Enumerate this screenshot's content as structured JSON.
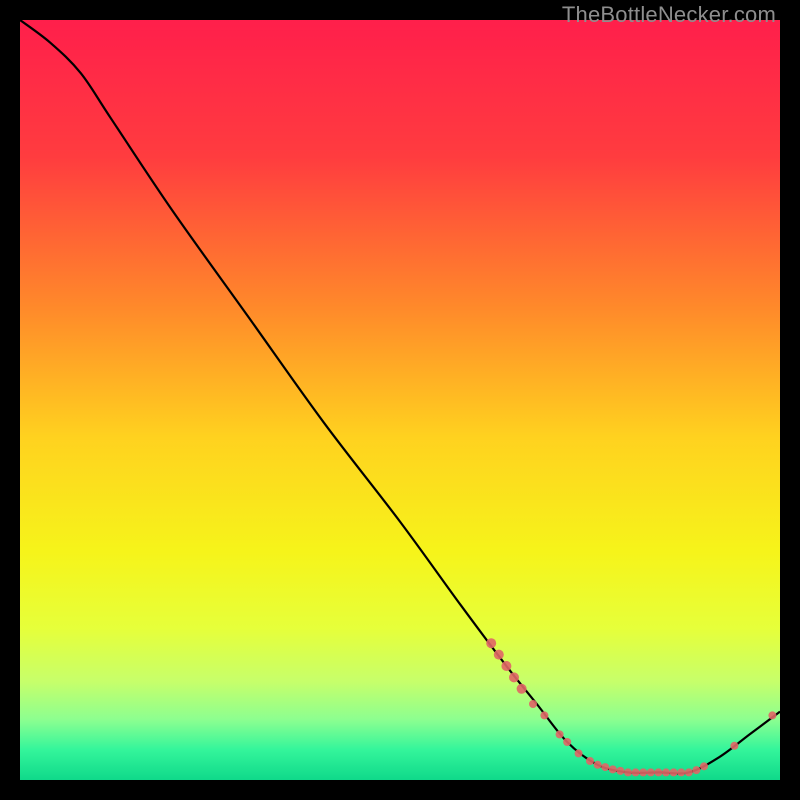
{
  "watermark": "TheBottleNecker.com",
  "chart_data": {
    "type": "line",
    "title": "",
    "xlabel": "",
    "ylabel": "",
    "xlim": [
      0,
      100
    ],
    "ylim": [
      0,
      100
    ],
    "gradient_stops": [
      {
        "offset": 0.0,
        "color": "#ff1f4b"
      },
      {
        "offset": 0.18,
        "color": "#ff3c3f"
      },
      {
        "offset": 0.38,
        "color": "#ff8a2a"
      },
      {
        "offset": 0.55,
        "color": "#ffd21f"
      },
      {
        "offset": 0.7,
        "color": "#f6f41a"
      },
      {
        "offset": 0.8,
        "color": "#e6ff3a"
      },
      {
        "offset": 0.87,
        "color": "#c7ff6a"
      },
      {
        "offset": 0.92,
        "color": "#8dff90"
      },
      {
        "offset": 0.96,
        "color": "#34f59b"
      },
      {
        "offset": 1.0,
        "color": "#0fd98a"
      }
    ],
    "curve": [
      {
        "x": 0,
        "y": 100
      },
      {
        "x": 4,
        "y": 97
      },
      {
        "x": 8,
        "y": 93
      },
      {
        "x": 12,
        "y": 87
      },
      {
        "x": 20,
        "y": 75
      },
      {
        "x": 30,
        "y": 61
      },
      {
        "x": 40,
        "y": 47
      },
      {
        "x": 50,
        "y": 34
      },
      {
        "x": 58,
        "y": 23
      },
      {
        "x": 64,
        "y": 15
      },
      {
        "x": 68,
        "y": 10
      },
      {
        "x": 72,
        "y": 5
      },
      {
        "x": 76,
        "y": 2
      },
      {
        "x": 80,
        "y": 1
      },
      {
        "x": 84,
        "y": 1
      },
      {
        "x": 88,
        "y": 1
      },
      {
        "x": 92,
        "y": 3
      },
      {
        "x": 96,
        "y": 6
      },
      {
        "x": 100,
        "y": 9
      }
    ],
    "highlight_points": [
      {
        "x": 62,
        "y": 18,
        "r": 5
      },
      {
        "x": 63,
        "y": 16.5,
        "r": 5
      },
      {
        "x": 64,
        "y": 15,
        "r": 5
      },
      {
        "x": 65,
        "y": 13.5,
        "r": 5
      },
      {
        "x": 66,
        "y": 12,
        "r": 5
      },
      {
        "x": 67.5,
        "y": 10,
        "r": 4
      },
      {
        "x": 69,
        "y": 8.5,
        "r": 4
      },
      {
        "x": 71,
        "y": 6,
        "r": 4
      },
      {
        "x": 72,
        "y": 5,
        "r": 4
      },
      {
        "x": 73.5,
        "y": 3.5,
        "r": 4
      },
      {
        "x": 75,
        "y": 2.5,
        "r": 4
      },
      {
        "x": 76,
        "y": 2,
        "r": 4
      },
      {
        "x": 77,
        "y": 1.7,
        "r": 4
      },
      {
        "x": 78,
        "y": 1.4,
        "r": 4
      },
      {
        "x": 79,
        "y": 1.2,
        "r": 4
      },
      {
        "x": 80,
        "y": 1,
        "r": 4
      },
      {
        "x": 81,
        "y": 1,
        "r": 4
      },
      {
        "x": 82,
        "y": 1,
        "r": 4
      },
      {
        "x": 83,
        "y": 1,
        "r": 4
      },
      {
        "x": 84,
        "y": 1,
        "r": 4
      },
      {
        "x": 85,
        "y": 1,
        "r": 4
      },
      {
        "x": 86,
        "y": 1,
        "r": 4
      },
      {
        "x": 87,
        "y": 1,
        "r": 4
      },
      {
        "x": 88,
        "y": 1,
        "r": 4
      },
      {
        "x": 89,
        "y": 1.3,
        "r": 4
      },
      {
        "x": 90,
        "y": 1.8,
        "r": 4
      },
      {
        "x": 94,
        "y": 4.5,
        "r": 4
      },
      {
        "x": 99,
        "y": 8.5,
        "r": 4
      }
    ]
  }
}
